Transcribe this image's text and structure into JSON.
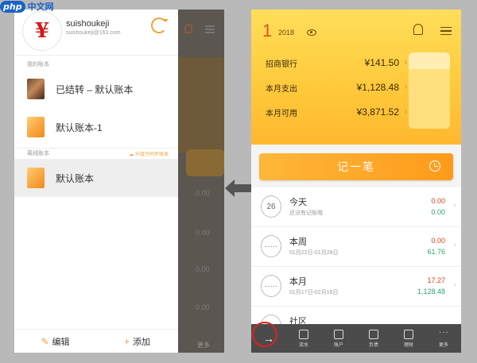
{
  "watermark": {
    "logo": "php",
    "text": "中文网"
  },
  "drawer": {
    "username": "suishoukeji",
    "email": "suishoukeji@163.com",
    "avatar_glyph": "¥",
    "my_books_label": "我的账本",
    "books": [
      {
        "name": "已结转 – 默认账本",
        "thumb": "photo"
      },
      {
        "name": "默认账本-1",
        "thumb": "orange"
      }
    ],
    "offline_label": "离线账本",
    "upgrade_text": "升级为同步账本",
    "offline_books": [
      {
        "name": "默认账本",
        "thumb": "orange",
        "selected": true
      }
    ],
    "footer": {
      "edit": "编辑",
      "add": "添加"
    }
  },
  "background_panel": {
    "values": [
      "0.00",
      "0.00",
      "0.00",
      "0.00"
    ],
    "more": "更多"
  },
  "main": {
    "month": "1",
    "year": "2018",
    "rows": [
      {
        "label": "招商银行",
        "amount": "¥141.50"
      },
      {
        "label": "本月支出",
        "amount": "¥1,128.48"
      },
      {
        "label": "本月可用",
        "amount": "¥3,871.52"
      }
    ],
    "budget_fill_fraction": 0.78,
    "record_button": "记一笔",
    "list": [
      {
        "title": "今天",
        "subtitle": "还没有记账哦",
        "icon_text": "26",
        "expense": "0.00",
        "income": "0.00"
      },
      {
        "title": "本周",
        "subtitle": "01月22日-01月28日",
        "icon_text": "·····",
        "expense": "0.00",
        "income": "61.76"
      },
      {
        "title": "本月",
        "subtitle": "01月17日-02月16日",
        "icon_text": "·····",
        "expense": "17.27",
        "income": "1,128.48"
      },
      {
        "title": "社区",
        "subtitle": "",
        "icon_text": "",
        "expense": "",
        "income": ""
      }
    ],
    "tabs": [
      "",
      "流水",
      "账户",
      "负债",
      "理财",
      "更多"
    ]
  },
  "colors": {
    "accent": "#ffb830",
    "expense": "#e0401a",
    "income": "#2ea36a",
    "highlight": "#e02020"
  }
}
